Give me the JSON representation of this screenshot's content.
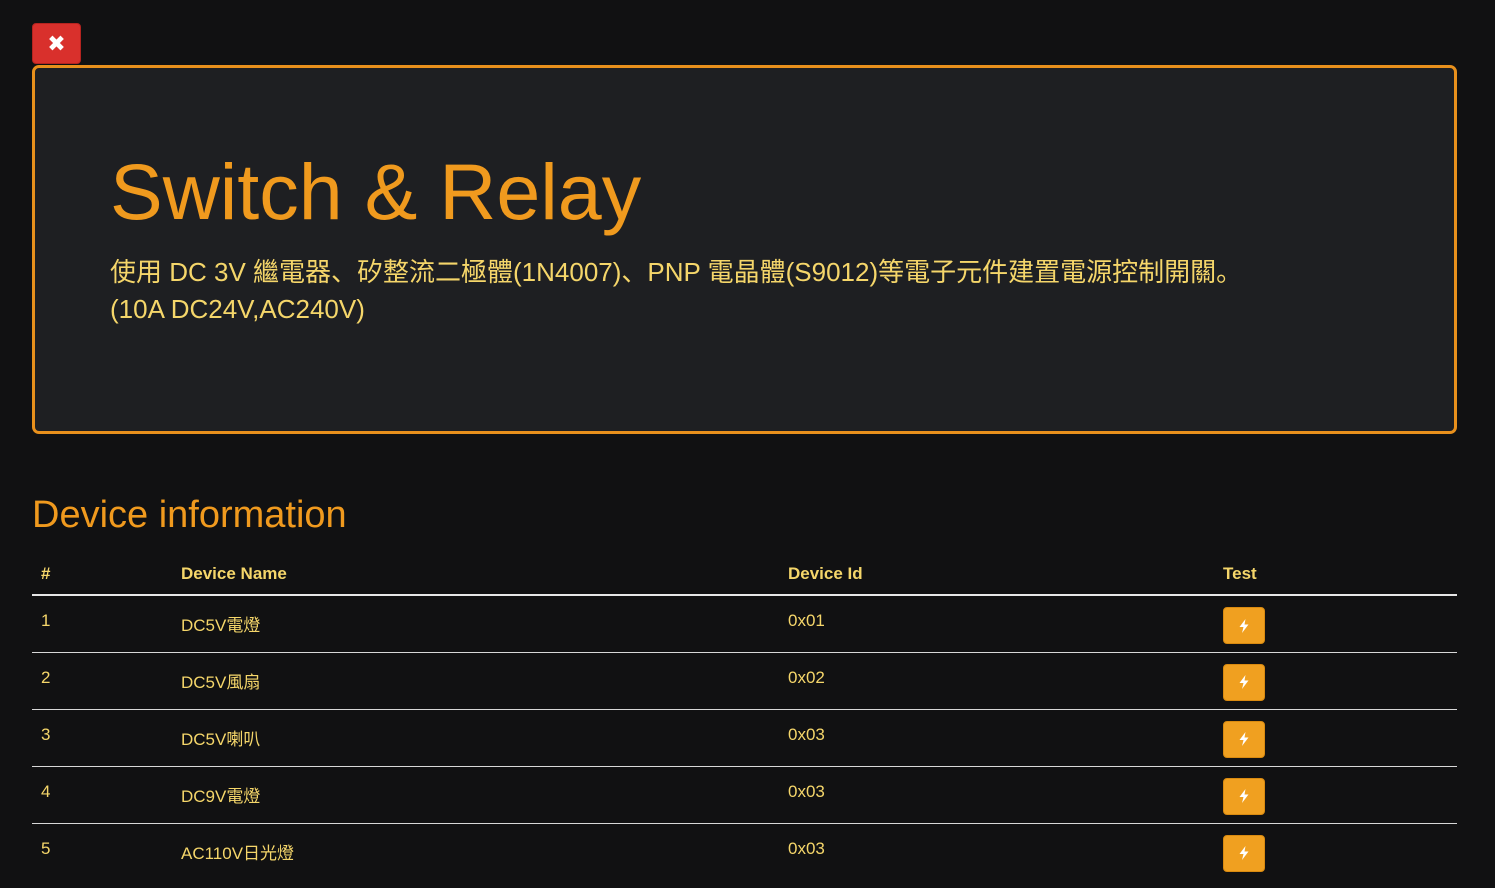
{
  "close_button": {
    "icon": "close-icon",
    "glyph": "✖",
    "color": "#d9302c"
  },
  "hero": {
    "title": "Switch & Relay",
    "description_line1": "使用 DC 3V 繼電器、矽整流二極體(1N4007)、PNP 電晶體(S9012)等電子元件建置電源控制開關。",
    "description_line2": "(10A DC24V,AC240V)",
    "accent_color": "#e8901c"
  },
  "section": {
    "title": "Device information"
  },
  "table": {
    "headers": {
      "num": "#",
      "name": "Device Name",
      "id": "Device Id",
      "test": "Test"
    },
    "rows": [
      {
        "num": "1",
        "name": "DC5V電燈",
        "id": "0x01"
      },
      {
        "num": "2",
        "name": "DC5V風扇",
        "id": "0x02"
      },
      {
        "num": "3",
        "name": "DC5V喇叭",
        "id": "0x03"
      },
      {
        "num": "4",
        "name": "DC9V電燈",
        "id": "0x03"
      },
      {
        "num": "5",
        "name": "AC110V日光燈",
        "id": "0x03"
      }
    ],
    "test_button_icon": "lightning-bolt-icon"
  },
  "colors": {
    "background": "#111112",
    "panel": "#1e1f22",
    "heading": "#f09a1e",
    "text": "#f5d66a",
    "button": "#f0a020"
  }
}
